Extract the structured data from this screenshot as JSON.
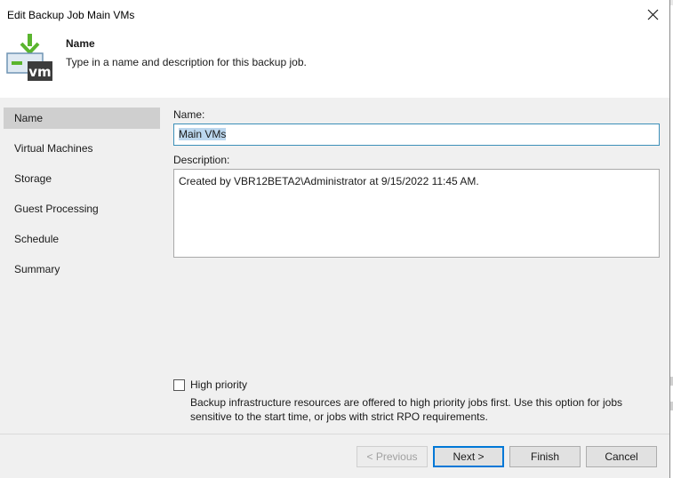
{
  "window": {
    "title": "Edit Backup Job Main VMs"
  },
  "header": {
    "title": "Name",
    "description": "Type in a name and description for this backup job.",
    "icon": "vm-backup-icon",
    "icon_badge": "vm"
  },
  "sidebar": {
    "items": [
      {
        "label": "Name",
        "active": true
      },
      {
        "label": "Virtual Machines",
        "active": false
      },
      {
        "label": "Storage",
        "active": false
      },
      {
        "label": "Guest Processing",
        "active": false
      },
      {
        "label": "Schedule",
        "active": false
      },
      {
        "label": "Summary",
        "active": false
      }
    ]
  },
  "form": {
    "name_label": "Name:",
    "name_value": "Main VMs",
    "description_label": "Description:",
    "description_value": "Created by VBR12BETA2\\Administrator at 9/15/2022 11:45 AM.",
    "high_priority_label": "High priority",
    "high_priority_checked": false,
    "high_priority_hint": "Backup infrastructure resources are offered to high priority jobs first. Use this option for jobs sensitive to the start time, or jobs with strict RPO requirements."
  },
  "footer": {
    "previous_label": "< Previous",
    "next_label": "Next >",
    "finish_label": "Finish",
    "cancel_label": "Cancel"
  },
  "colors": {
    "accent": "#0078d7",
    "sidebar_active": "#cfcfcf",
    "panel_bg": "#f0f0f0",
    "icon_green": "#5ab52e",
    "icon_dark": "#3c3c3c"
  }
}
